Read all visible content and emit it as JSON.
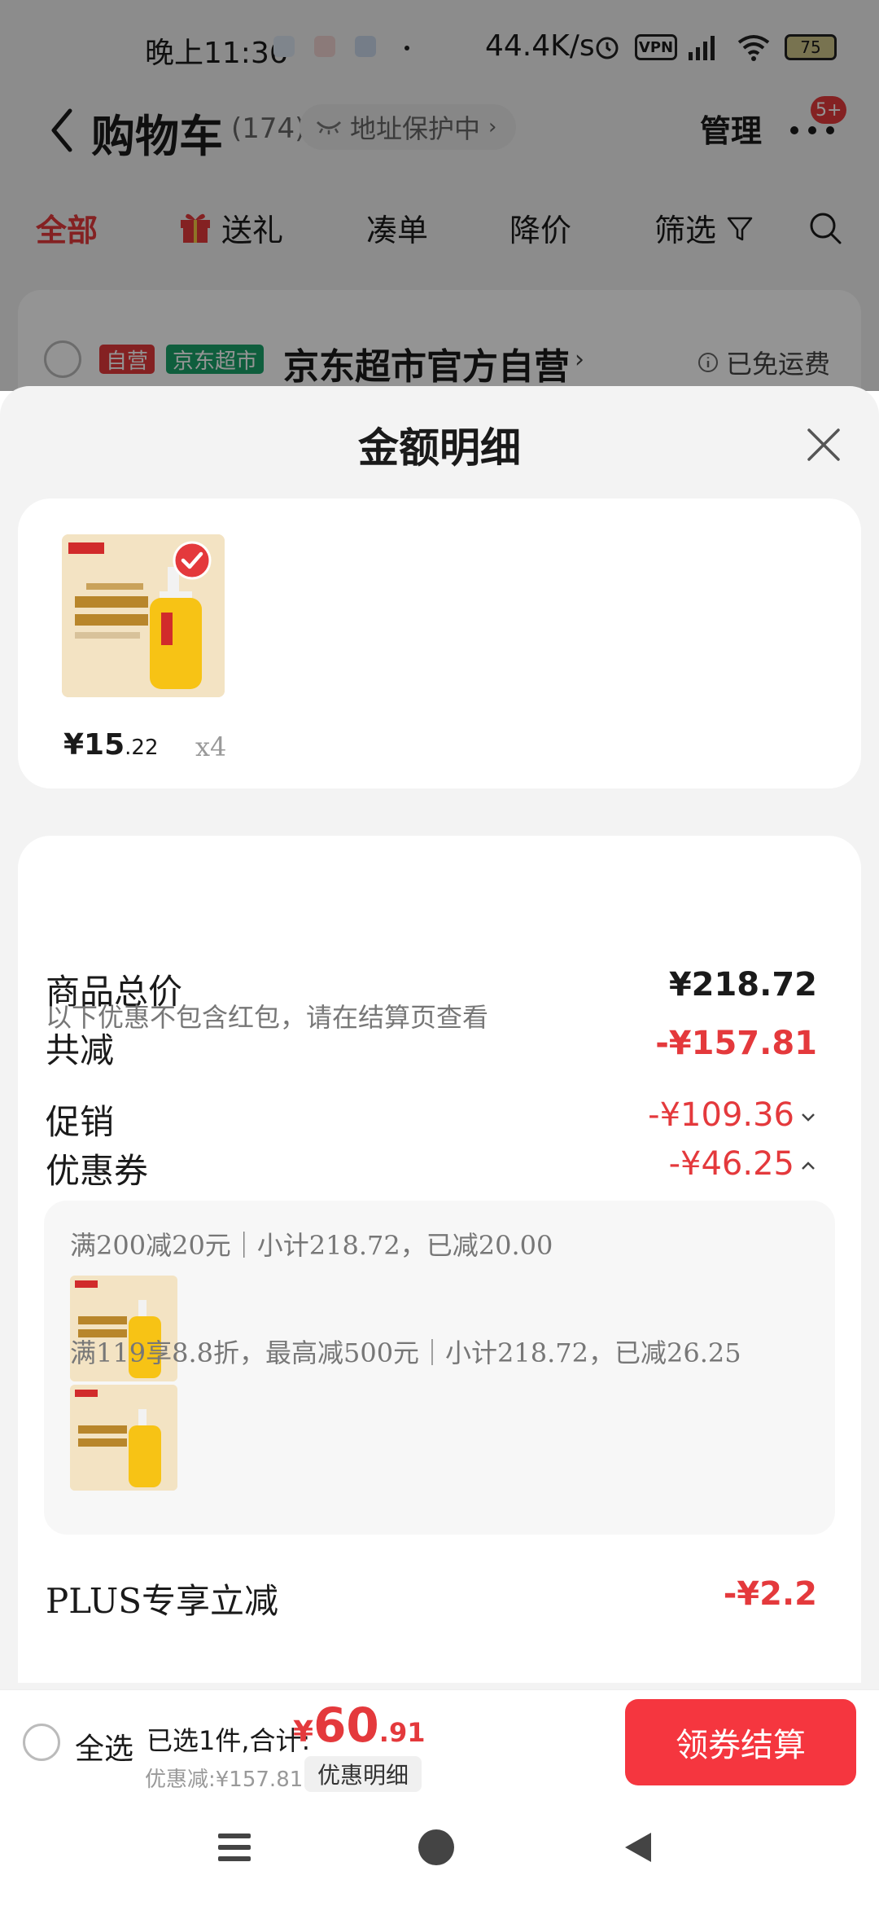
{
  "status_bar": {
    "time": "晚上11:36",
    "speed": "44.4K/s",
    "vpn": "VPN",
    "battery": "75"
  },
  "header": {
    "title": "购物车",
    "count": "(174)",
    "address_protect": "地址保护中",
    "manage": "管理",
    "more_badge": "5+"
  },
  "tabs": [
    {
      "label": "全部",
      "active": true
    },
    {
      "label": "送礼"
    },
    {
      "label": "凑单"
    },
    {
      "label": "降价"
    },
    {
      "label": "筛选"
    }
  ],
  "shop": {
    "tag_self": "自营",
    "tag_market": "京东超市",
    "name": "京东超市官方自营",
    "shipping": "已免运费"
  },
  "sheet": {
    "title": "金额明细",
    "product": {
      "price_int": "¥15",
      "price_dec": ".22",
      "qty": "x4"
    },
    "rows": {
      "total_label": "商品总价",
      "total_value": "¥218.72",
      "reduce_label": "共减",
      "reduce_value": "-¥157.81",
      "reduce_note": "以下优惠不包含红包，请在结算页查看",
      "promo_label": "促销",
      "promo_value": "-¥109.36",
      "coupon_label": "优惠券",
      "coupon_value": "-¥46.25",
      "plus_label": "PLUS专享立减",
      "plus_value": "-¥2.2"
    },
    "coupons": [
      {
        "text": "满200减20元｜小计218.72，已减20.00"
      },
      {
        "text": "满119享8.8折，最高减500元｜小计218.72，已减26.25"
      }
    ]
  },
  "bottom_bar": {
    "select_all": "全选",
    "selected_text": "已选1件,合计:",
    "total_sym": "¥",
    "total_int": "60",
    "total_dec": ".91",
    "discount_text": "优惠减:¥157.81",
    "detail_chip": "优惠明细",
    "checkout": "领券结算"
  },
  "colors": {
    "accent": "#e4393c",
    "checkout": "#f5363f",
    "market_tag": "#1aa26a"
  }
}
